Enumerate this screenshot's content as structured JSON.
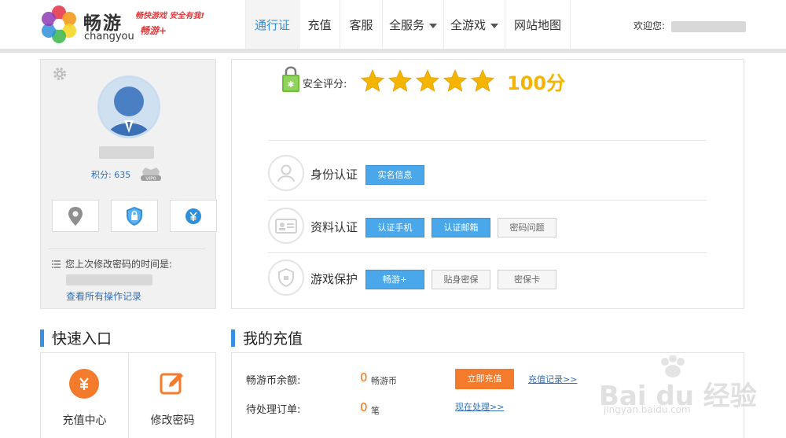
{
  "header": {
    "logo": {
      "cn": "畅游",
      "en": "changyou",
      "slogan": "畅快游戏 安全有我!",
      "plus": "畅游+"
    },
    "nav": [
      {
        "label": "通行证",
        "active": true,
        "dropdown": false
      },
      {
        "label": "充值",
        "active": false,
        "dropdown": false
      },
      {
        "label": "客服",
        "active": false,
        "dropdown": false
      },
      {
        "label": "全服务",
        "active": false,
        "dropdown": true
      },
      {
        "label": "全游戏",
        "active": false,
        "dropdown": true
      },
      {
        "label": "网站地图",
        "active": false,
        "dropdown": false
      }
    ],
    "welcome": "欢迎您:"
  },
  "profile": {
    "points_label": "积分:",
    "points_value": "635",
    "vip_badge": "VIP0",
    "last_pwd_change_label": "您上次修改密码的时间是:",
    "view_log_link": "查看所有操作记录"
  },
  "security": {
    "score_label": "安全评分:",
    "stars": 5,
    "score_value": "100分",
    "rows": [
      {
        "label": "身份认证",
        "buttons": [
          {
            "label": "实名信息",
            "style": "blue"
          }
        ]
      },
      {
        "label": "资料认证",
        "buttons": [
          {
            "label": "认证手机",
            "style": "blue"
          },
          {
            "label": "认证邮箱",
            "style": "blue"
          },
          {
            "label": "密码问题",
            "style": "gray"
          }
        ]
      },
      {
        "label": "游戏保护",
        "buttons": [
          {
            "label": "畅游+",
            "style": "blue"
          },
          {
            "label": "贴身密保",
            "style": "gray"
          },
          {
            "label": "密保卡",
            "style": "gray"
          }
        ]
      }
    ]
  },
  "quick_entry": {
    "title": "快速入口",
    "items": [
      {
        "label": "充值中心",
        "icon": "yuan-icon",
        "color": "#f47a2c"
      },
      {
        "label": "修改密码",
        "icon": "edit-icon",
        "color": "#f47a2c"
      }
    ]
  },
  "recharge": {
    "title": "我的充值",
    "balance_label": "畅游币余额:",
    "balance_value": "0",
    "balance_unit": "畅游币",
    "pending_label": "待处理订单:",
    "pending_value": "0",
    "pending_unit": "笔",
    "recharge_button": "立即充值",
    "records_link": "充值记录>>",
    "process_link": "现在处理>>"
  },
  "watermark": {
    "text": "Bai du 经验",
    "url": "jingyan.baidu.com"
  },
  "colors": {
    "accent": "#2f8fd8",
    "blue_button": "#4aa7ea",
    "orange": "#f47a2c",
    "score": "#f4b400"
  }
}
